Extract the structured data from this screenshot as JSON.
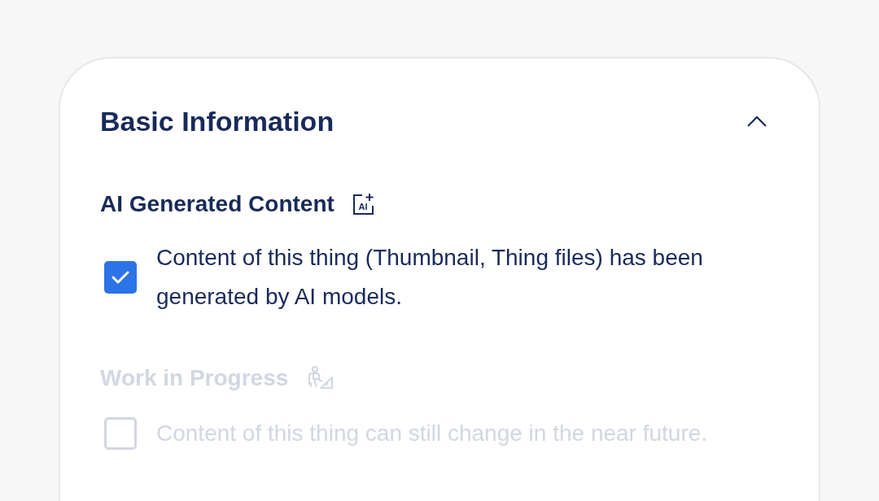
{
  "section": {
    "title": "Basic Information",
    "expanded": true,
    "fields": [
      {
        "title": "AI Generated Content",
        "icon_text": "AI",
        "disabled": false,
        "checked": true,
        "description": "Content of this thing (Thumbnail, Thing files) has been generated by AI models."
      },
      {
        "title": "Work in Progress",
        "disabled": true,
        "checked": false,
        "description": "Content of this thing can still change in the near future."
      }
    ]
  }
}
